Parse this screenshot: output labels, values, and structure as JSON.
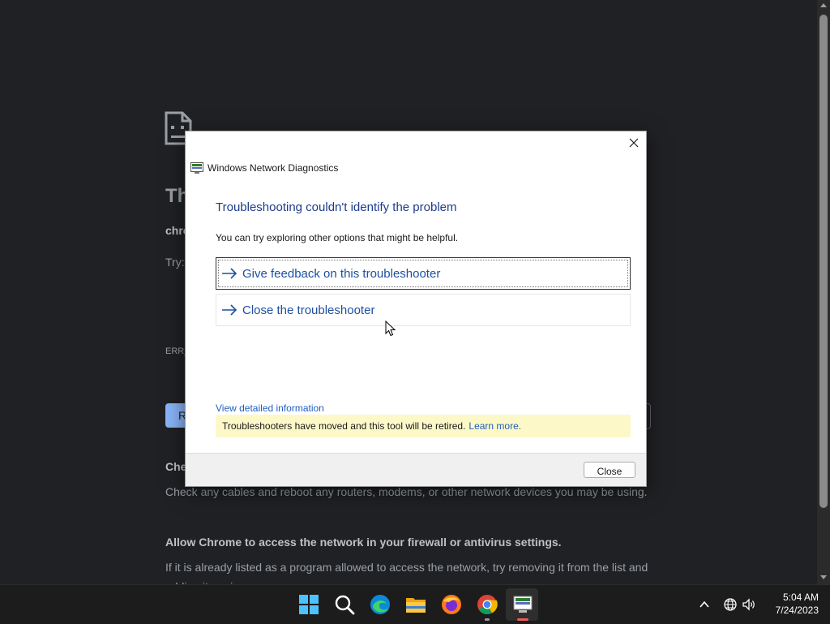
{
  "background_page": {
    "heading": "Th",
    "domain": "chro",
    "try_label": "Try:",
    "error_code": "ERR_",
    "reload_button_label": "R",
    "check_heading": "Che",
    "check_text": "Check any cables and reboot any routers, modems, or other network devices you may be using.",
    "firewall_heading": "Allow Chrome to access the network in your firewall or antivirus settings.",
    "firewall_text": "If it is already listed as a program allowed to access the network, try removing it from the list and adding it again."
  },
  "dialog": {
    "title": "Windows Network Diagnostics",
    "heading": "Troubleshooting couldn't identify the problem",
    "subtext": "You can try exploring other options that might be helpful.",
    "options": [
      {
        "label": "Give feedback on this troubleshooter"
      },
      {
        "label": "Close the troubleshooter"
      }
    ],
    "detail_link": "View detailed information",
    "retire_notice": "Troubleshooters have moved and this tool will be retired.",
    "learn_more": "Learn more.",
    "close_button": "Close"
  },
  "taskbar": {
    "apps": [
      "start-icon",
      "search-icon",
      "edge-icon",
      "file-explorer-icon",
      "firefox-icon",
      "chrome-icon",
      "network-diagnostics-icon"
    ],
    "active_app": "network-diagnostics-icon",
    "tray": [
      "chevron-up-icon",
      "globe-icon",
      "speaker-icon"
    ],
    "time": "5:04 AM",
    "date": "7/24/2023"
  },
  "colors": {
    "dialog_heading": "#1e3c8c",
    "link": "#1f5fbf",
    "notice_bg": "#fdf8c8",
    "chrome_bg": "#202124",
    "taskbar_bg": "#1c1c1c"
  }
}
